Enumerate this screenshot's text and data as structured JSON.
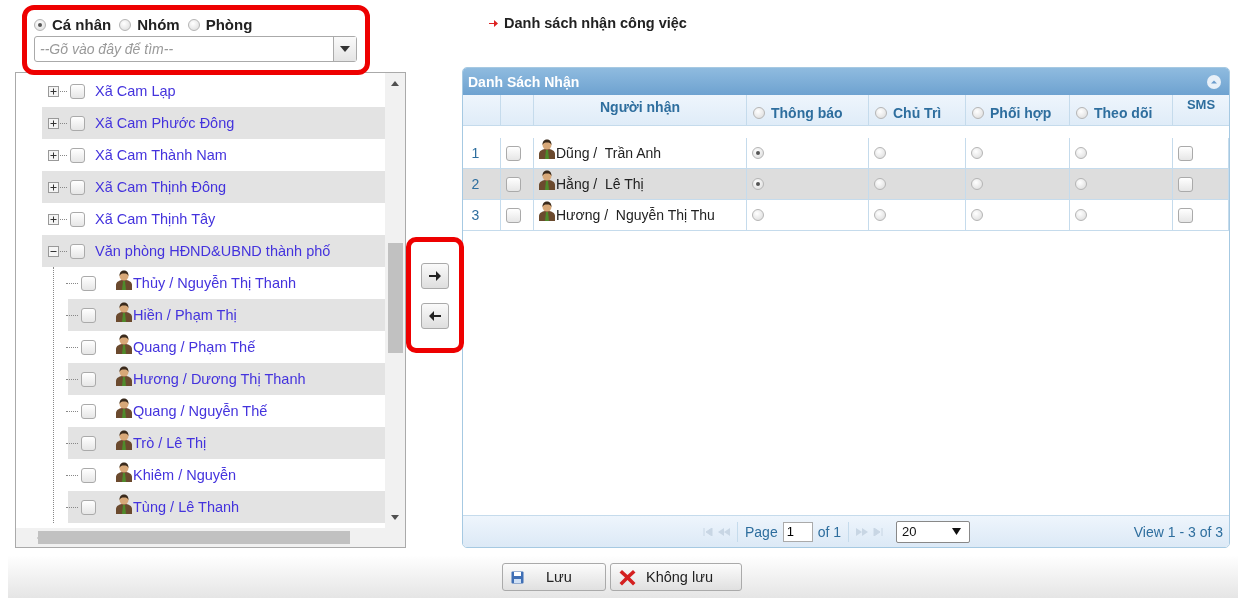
{
  "search_panel": {
    "options": [
      {
        "label": "Cá nhân",
        "selected": true
      },
      {
        "label": "Nhóm",
        "selected": false
      },
      {
        "label": "Phòng",
        "selected": false
      }
    ],
    "search": {
      "placeholder": "--Gõ vào đây để tìm--"
    }
  },
  "tree": [
    {
      "label": "Xã Cam Lạp",
      "expanded": false,
      "checked": false
    },
    {
      "label": "Xã Cam Phước Đông",
      "expanded": false,
      "checked": false
    },
    {
      "label": "Xã Cam Thành Nam",
      "expanded": false,
      "checked": false
    },
    {
      "label": "Xã Cam Thịnh Đông",
      "expanded": false,
      "checked": false
    },
    {
      "label": "Xã Cam Thịnh Tây",
      "expanded": false,
      "checked": false
    },
    {
      "label": "Văn phòng HĐND&UBND thành phố",
      "expanded": true,
      "checked": false,
      "children": [
        {
          "label": "Thủy / Nguyễn Thị Thanh",
          "checked": false
        },
        {
          "label": "Hiền / Phạm Thị",
          "checked": false
        },
        {
          "label": "Quang / Phạm Thế",
          "checked": false
        },
        {
          "label": "Hương / Dương Thị Thanh",
          "checked": false
        },
        {
          "label": "Quang / Nguyễn Thế",
          "checked": false
        },
        {
          "label": "Trò / Lê Thị",
          "checked": false
        },
        {
          "label": "Khiêm / Nguyễn",
          "checked": false
        },
        {
          "label": "Tùng / Lê Thanh",
          "checked": false
        }
      ]
    }
  ],
  "heading": "Danh sách nhận công việc",
  "grid": {
    "title": "Danh Sách Nhận",
    "columns": [
      {
        "label": "Người nhận",
        "kind": "name"
      },
      {
        "label": "Thông báo",
        "kind": "role",
        "selected": false
      },
      {
        "label": "Chủ Trì",
        "kind": "role",
        "selected": false
      },
      {
        "label": "Phối hợp",
        "kind": "role",
        "selected": false
      },
      {
        "label": "Theo dõi",
        "kind": "role",
        "selected": false
      },
      {
        "label": "SMS",
        "kind": "sms"
      }
    ],
    "rows": [
      {
        "index": "1",
        "checked": false,
        "name": "Dũng /  Trần Anh",
        "selected": false,
        "roles": [
          {
            "selected": true
          },
          {
            "selected": false
          },
          {
            "selected": false
          },
          {
            "selected": false
          }
        ],
        "sms": false
      },
      {
        "index": "2",
        "checked": false,
        "name": "Hằng /  Lê Thị",
        "selected": true,
        "roles": [
          {
            "selected": true
          },
          {
            "selected": false
          },
          {
            "selected": false
          },
          {
            "selected": false
          }
        ],
        "sms": false
      },
      {
        "index": "3",
        "checked": false,
        "name": "Hương /  Nguyễn Thị Thu",
        "selected": false,
        "roles": [
          {
            "selected": false
          },
          {
            "selected": false
          },
          {
            "selected": false
          },
          {
            "selected": false
          }
        ],
        "sms": false
      }
    ],
    "pager": {
      "page_label": "Page",
      "page": "1",
      "of": "of 1",
      "page_size": "20",
      "summary": "View 1 - 3 of 3"
    }
  },
  "buttons": [
    {
      "label": "Lưu",
      "kind": "save"
    },
    {
      "label": "Không lưu",
      "kind": "cancel"
    }
  ]
}
